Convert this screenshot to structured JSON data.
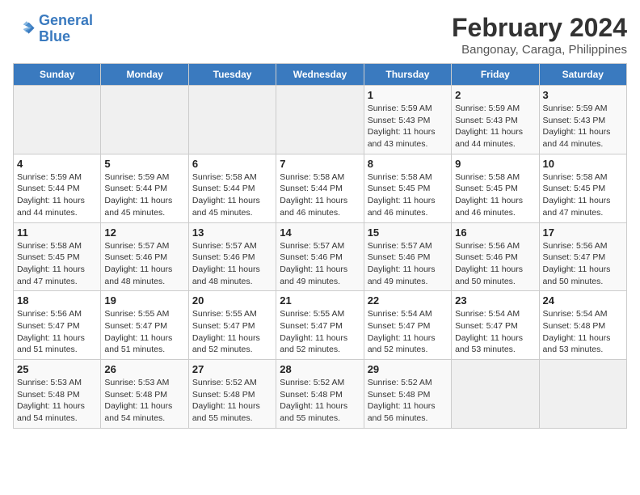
{
  "header": {
    "logo_line1": "General",
    "logo_line2": "Blue",
    "title": "February 2024",
    "subtitle": "Bangonay, Caraga, Philippines"
  },
  "weekdays": [
    "Sunday",
    "Monday",
    "Tuesday",
    "Wednesday",
    "Thursday",
    "Friday",
    "Saturday"
  ],
  "weeks": [
    [
      {
        "day": "",
        "info": ""
      },
      {
        "day": "",
        "info": ""
      },
      {
        "day": "",
        "info": ""
      },
      {
        "day": "",
        "info": ""
      },
      {
        "day": "1",
        "info": "Sunrise: 5:59 AM\nSunset: 5:43 PM\nDaylight: 11 hours\nand 43 minutes."
      },
      {
        "day": "2",
        "info": "Sunrise: 5:59 AM\nSunset: 5:43 PM\nDaylight: 11 hours\nand 44 minutes."
      },
      {
        "day": "3",
        "info": "Sunrise: 5:59 AM\nSunset: 5:43 PM\nDaylight: 11 hours\nand 44 minutes."
      }
    ],
    [
      {
        "day": "4",
        "info": "Sunrise: 5:59 AM\nSunset: 5:44 PM\nDaylight: 11 hours\nand 44 minutes."
      },
      {
        "day": "5",
        "info": "Sunrise: 5:59 AM\nSunset: 5:44 PM\nDaylight: 11 hours\nand 45 minutes."
      },
      {
        "day": "6",
        "info": "Sunrise: 5:58 AM\nSunset: 5:44 PM\nDaylight: 11 hours\nand 45 minutes."
      },
      {
        "day": "7",
        "info": "Sunrise: 5:58 AM\nSunset: 5:44 PM\nDaylight: 11 hours\nand 46 minutes."
      },
      {
        "day": "8",
        "info": "Sunrise: 5:58 AM\nSunset: 5:45 PM\nDaylight: 11 hours\nand 46 minutes."
      },
      {
        "day": "9",
        "info": "Sunrise: 5:58 AM\nSunset: 5:45 PM\nDaylight: 11 hours\nand 46 minutes."
      },
      {
        "day": "10",
        "info": "Sunrise: 5:58 AM\nSunset: 5:45 PM\nDaylight: 11 hours\nand 47 minutes."
      }
    ],
    [
      {
        "day": "11",
        "info": "Sunrise: 5:58 AM\nSunset: 5:45 PM\nDaylight: 11 hours\nand 47 minutes."
      },
      {
        "day": "12",
        "info": "Sunrise: 5:57 AM\nSunset: 5:46 PM\nDaylight: 11 hours\nand 48 minutes."
      },
      {
        "day": "13",
        "info": "Sunrise: 5:57 AM\nSunset: 5:46 PM\nDaylight: 11 hours\nand 48 minutes."
      },
      {
        "day": "14",
        "info": "Sunrise: 5:57 AM\nSunset: 5:46 PM\nDaylight: 11 hours\nand 49 minutes."
      },
      {
        "day": "15",
        "info": "Sunrise: 5:57 AM\nSunset: 5:46 PM\nDaylight: 11 hours\nand 49 minutes."
      },
      {
        "day": "16",
        "info": "Sunrise: 5:56 AM\nSunset: 5:46 PM\nDaylight: 11 hours\nand 50 minutes."
      },
      {
        "day": "17",
        "info": "Sunrise: 5:56 AM\nSunset: 5:47 PM\nDaylight: 11 hours\nand 50 minutes."
      }
    ],
    [
      {
        "day": "18",
        "info": "Sunrise: 5:56 AM\nSunset: 5:47 PM\nDaylight: 11 hours\nand 51 minutes."
      },
      {
        "day": "19",
        "info": "Sunrise: 5:55 AM\nSunset: 5:47 PM\nDaylight: 11 hours\nand 51 minutes."
      },
      {
        "day": "20",
        "info": "Sunrise: 5:55 AM\nSunset: 5:47 PM\nDaylight: 11 hours\nand 52 minutes."
      },
      {
        "day": "21",
        "info": "Sunrise: 5:55 AM\nSunset: 5:47 PM\nDaylight: 11 hours\nand 52 minutes."
      },
      {
        "day": "22",
        "info": "Sunrise: 5:54 AM\nSunset: 5:47 PM\nDaylight: 11 hours\nand 52 minutes."
      },
      {
        "day": "23",
        "info": "Sunrise: 5:54 AM\nSunset: 5:47 PM\nDaylight: 11 hours\nand 53 minutes."
      },
      {
        "day": "24",
        "info": "Sunrise: 5:54 AM\nSunset: 5:48 PM\nDaylight: 11 hours\nand 53 minutes."
      }
    ],
    [
      {
        "day": "25",
        "info": "Sunrise: 5:53 AM\nSunset: 5:48 PM\nDaylight: 11 hours\nand 54 minutes."
      },
      {
        "day": "26",
        "info": "Sunrise: 5:53 AM\nSunset: 5:48 PM\nDaylight: 11 hours\nand 54 minutes."
      },
      {
        "day": "27",
        "info": "Sunrise: 5:52 AM\nSunset: 5:48 PM\nDaylight: 11 hours\nand 55 minutes."
      },
      {
        "day": "28",
        "info": "Sunrise: 5:52 AM\nSunset: 5:48 PM\nDaylight: 11 hours\nand 55 minutes."
      },
      {
        "day": "29",
        "info": "Sunrise: 5:52 AM\nSunset: 5:48 PM\nDaylight: 11 hours\nand 56 minutes."
      },
      {
        "day": "",
        "info": ""
      },
      {
        "day": "",
        "info": ""
      }
    ]
  ]
}
